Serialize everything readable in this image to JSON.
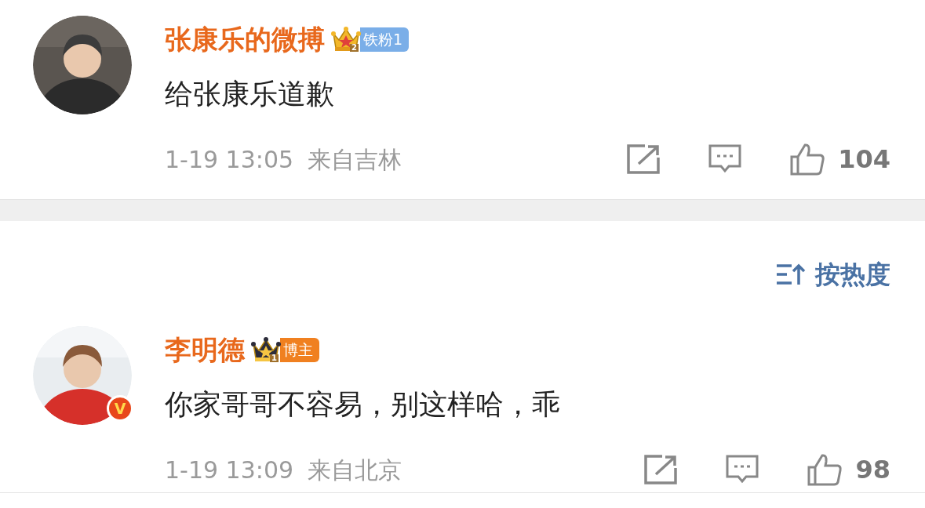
{
  "top_comment": {
    "user": "张康乐的微搏",
    "badge": {
      "kind": "fan",
      "level": "2",
      "label": "铁粉1"
    },
    "text": "给张康乐道歉",
    "time": "1-19 13:05",
    "location": "来自吉林",
    "likes": "104"
  },
  "sort": {
    "label": "按热度"
  },
  "comments": [
    {
      "user": "李明德",
      "badge": {
        "kind": "blogger",
        "level": "1",
        "label": "博主"
      },
      "verified_badge": "V",
      "text": "你家哥哥不容易，别这样哈，乖",
      "time": "1-19 13:09",
      "location": "来自北京",
      "likes": "98"
    }
  ]
}
